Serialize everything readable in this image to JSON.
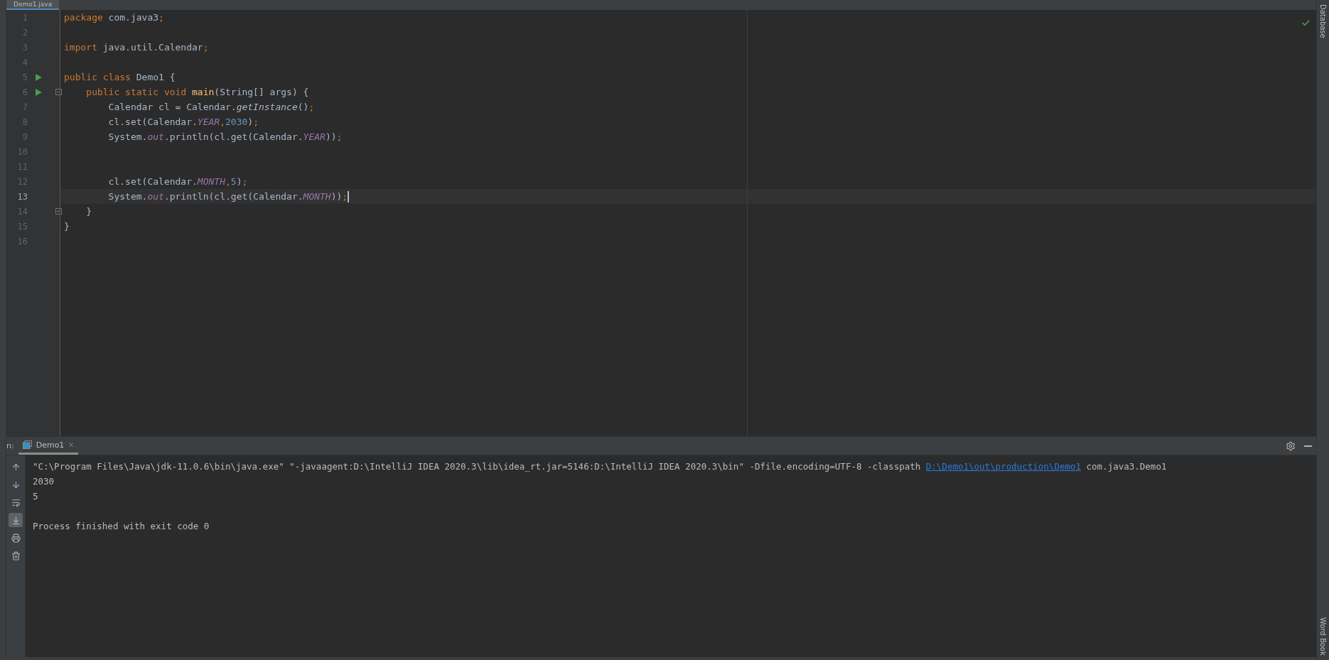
{
  "editor_tab": {
    "label": "Demo1.java",
    "selected": true
  },
  "code_lines": [
    {
      "number": "1",
      "runnable": false,
      "fold": false,
      "current": false,
      "tokens": [
        {
          "kind": "keyword",
          "text": "package"
        },
        {
          "kind": "plain",
          "text": " com.java3"
        },
        {
          "kind": "punct",
          "text": ";"
        }
      ]
    },
    {
      "number": "2",
      "runnable": false,
      "fold": false,
      "current": false
    },
    {
      "number": "3",
      "runnable": false,
      "fold": false,
      "current": false,
      "tokens": [
        {
          "kind": "keyword",
          "text": "import"
        },
        {
          "kind": "plain",
          "text": " java.util.Calendar"
        },
        {
          "kind": "punct",
          "text": ";"
        }
      ]
    },
    {
      "number": "4",
      "runnable": false,
      "fold": false,
      "current": false
    },
    {
      "number": "5",
      "runnable": true,
      "fold": false,
      "current": false,
      "tokens": [
        {
          "kind": "keyword",
          "text": "public class"
        },
        {
          "kind": "plain",
          "text": " Demo1 {"
        }
      ]
    },
    {
      "number": "6",
      "runnable": true,
      "fold": true,
      "current": false,
      "tokens": [
        {
          "kind": "keyword",
          "text": "    public static void"
        },
        {
          "kind": "method",
          "text": " main"
        },
        {
          "kind": "plain",
          "text": "(String[] args) {"
        }
      ]
    },
    {
      "number": "7",
      "runnable": false,
      "fold": false,
      "current": false,
      "tokens": [
        {
          "kind": "plain",
          "text": "        Calendar cl = Calendar."
        },
        {
          "kind": "call",
          "text": "getInstance"
        },
        {
          "kind": "plain",
          "text": "()"
        },
        {
          "kind": "punct",
          "text": ";"
        }
      ]
    },
    {
      "number": "8",
      "runnable": false,
      "fold": false,
      "current": false,
      "tokens": [
        {
          "kind": "plain",
          "text": "        cl.set(Calendar."
        },
        {
          "kind": "field",
          "text": "YEAR"
        },
        {
          "kind": "punct",
          "text": ","
        },
        {
          "kind": "number",
          "text": "2030"
        },
        {
          "kind": "plain",
          "text": ")"
        },
        {
          "kind": "punct",
          "text": ";"
        }
      ]
    },
    {
      "number": "9",
      "runnable": false,
      "fold": false,
      "current": false,
      "tokens": [
        {
          "kind": "plain",
          "text": "        System."
        },
        {
          "kind": "field",
          "text": "out"
        },
        {
          "kind": "plain",
          "text": ".println(cl.get(Calendar."
        },
        {
          "kind": "field",
          "text": "YEAR"
        },
        {
          "kind": "plain",
          "text": "))"
        },
        {
          "kind": "punct",
          "text": ";"
        }
      ]
    },
    {
      "number": "10",
      "runnable": false,
      "fold": false,
      "current": false
    },
    {
      "number": "11",
      "runnable": false,
      "fold": false,
      "current": false
    },
    {
      "number": "12",
      "runnable": false,
      "fold": false,
      "current": false,
      "tokens": [
        {
          "kind": "plain",
          "text": "        cl.set(Calendar."
        },
        {
          "kind": "field",
          "text": "MONTH"
        },
        {
          "kind": "punct",
          "text": ","
        },
        {
          "kind": "number",
          "text": "5"
        },
        {
          "kind": "plain",
          "text": ")"
        },
        {
          "kind": "punct",
          "text": ";"
        }
      ]
    },
    {
      "number": "13",
      "runnable": false,
      "fold": false,
      "current": true,
      "tokens": [
        {
          "kind": "plain",
          "text": "        System."
        },
        {
          "kind": "field",
          "text": "out"
        },
        {
          "kind": "plain",
          "text": ".println(cl.get(Calendar."
        },
        {
          "kind": "field",
          "text": "MONTH"
        },
        {
          "kind": "plain",
          "text": "))"
        },
        {
          "kind": "punct",
          "text": ";"
        }
      ]
    },
    {
      "number": "14",
      "runnable": false,
      "fold": true,
      "current": false,
      "tokens": [
        {
          "kind": "plain",
          "text": "    }"
        }
      ]
    },
    {
      "number": "15",
      "runnable": false,
      "fold": false,
      "current": false,
      "tokens": [
        {
          "kind": "plain",
          "text": "}"
        }
      ]
    },
    {
      "number": "16",
      "runnable": false,
      "fold": false,
      "current": false
    }
  ],
  "right_strip": {
    "top_label": "Database",
    "bottom_label": "Word Book"
  },
  "run_panel": {
    "prefix": "n:",
    "tab": {
      "label": "Demo1",
      "selected": true
    },
    "output": [
      {
        "kind": "text",
        "parts": [
          {
            "kind": "text",
            "text": "\"C:\\Program Files\\Java\\jdk-11.0.6\\bin\\java.exe\" \"-javaagent:D:\\IntelliJ IDEA 2020.3\\lib\\idea_rt.jar=5146:D:\\IntelliJ IDEA 2020.3\\bin\" -Dfile.encoding=UTF-8 -classpath "
          },
          {
            "kind": "link",
            "text": "D:\\Demo1\\out\\production\\Demo1"
          },
          {
            "kind": "text",
            "text": " com.java3.Demo1"
          }
        ]
      },
      {
        "kind": "text",
        "parts": [
          {
            "kind": "text",
            "text": "2030"
          }
        ]
      },
      {
        "kind": "text",
        "parts": [
          {
            "kind": "text",
            "text": "5"
          }
        ]
      },
      {
        "kind": "blank"
      },
      {
        "kind": "text",
        "parts": [
          {
            "kind": "text",
            "text": "Process finished with exit code 0"
          }
        ]
      }
    ],
    "tools": [
      {
        "kind": "up",
        "selected": false
      },
      {
        "kind": "down",
        "selected": false
      },
      {
        "kind": "wrap",
        "selected": false
      },
      {
        "kind": "scroll-end",
        "selected": true
      },
      {
        "kind": "print",
        "selected": false
      },
      {
        "kind": "trash",
        "selected": false
      }
    ]
  }
}
